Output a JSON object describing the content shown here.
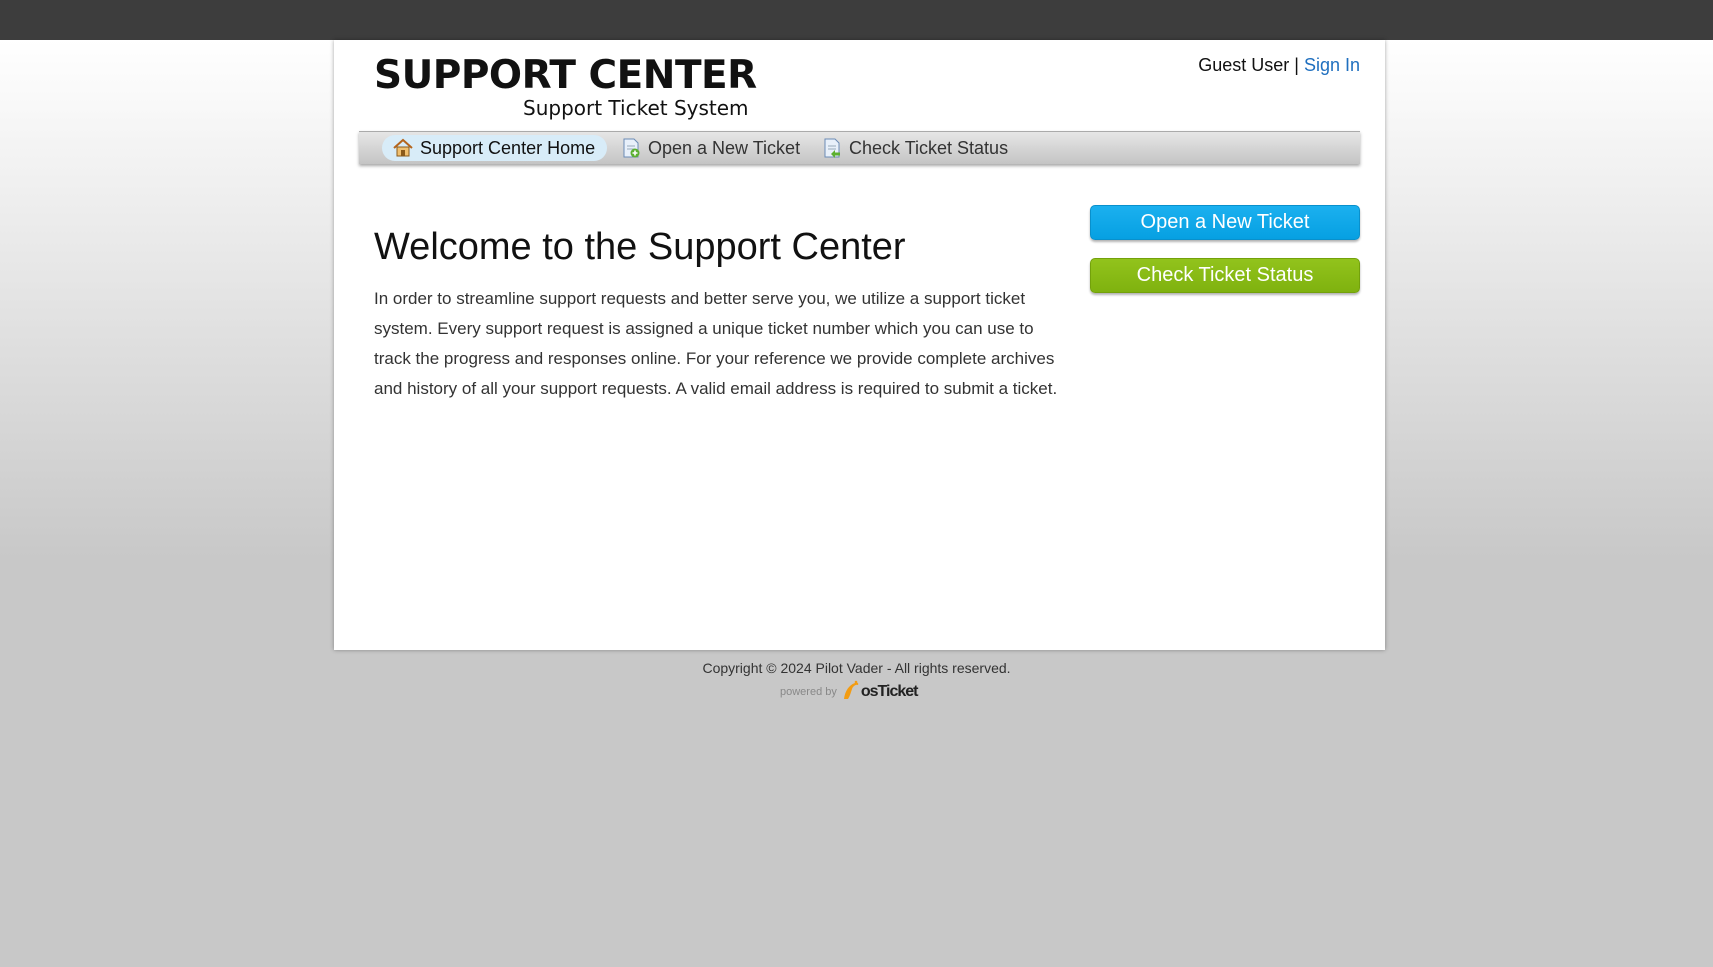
{
  "header": {
    "logo_title": "SUPPORT CENTER",
    "logo_subtitle": "Support Ticket System",
    "user_label": "Guest User",
    "separator": "|",
    "sign_in": "Sign In"
  },
  "nav": {
    "items": [
      {
        "label": "Support Center Home",
        "icon": "home-icon",
        "active": true
      },
      {
        "label": "Open a New Ticket",
        "icon": "new-ticket-icon",
        "active": false
      },
      {
        "label": "Check Ticket Status",
        "icon": "ticket-status-icon",
        "active": false
      }
    ]
  },
  "main": {
    "title": "Welcome to the Support Center",
    "intro": "In order to streamline support requests and better serve you, we utilize a support ticket system. Every support request is assigned a unique ticket number which you can use to track the progress and responses online. For your reference we provide complete archives and history of all your support requests. A valid email address is required to submit a ticket."
  },
  "sidebar": {
    "open_ticket_button": "Open a New Ticket",
    "check_status_button": "Check Ticket Status"
  },
  "footer": {
    "copyright": "Copyright © 2024 Pilot Vader - All rights reserved.",
    "powered_by": "powered by",
    "brand": "osTicket"
  },
  "colors": {
    "topbar": "#3d3d3d",
    "link": "#1f6fbf",
    "button_blue": "#06a0e2",
    "button_green": "#7fb20f",
    "nav_active": "#d8ecf8"
  }
}
